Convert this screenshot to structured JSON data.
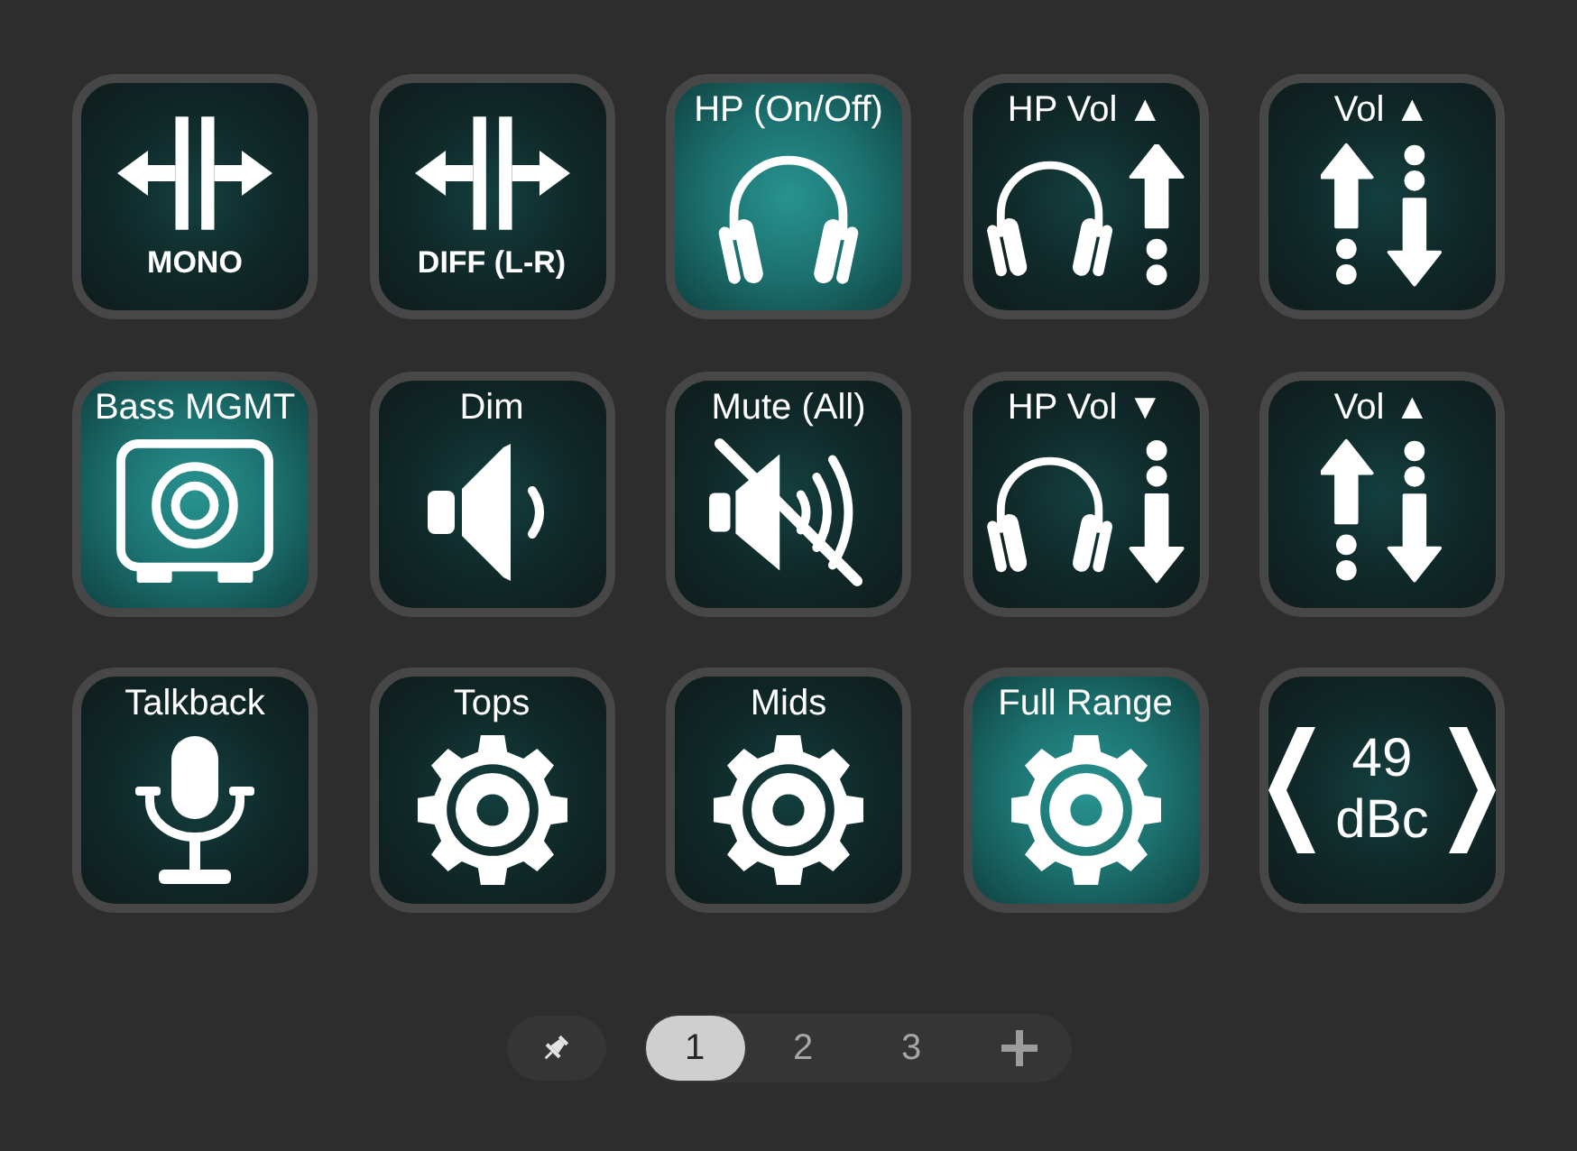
{
  "keys": [
    {
      "kind": "caption",
      "label": "MONO",
      "on": false
    },
    {
      "kind": "caption",
      "label": "DIFF (L-R)",
      "on": false
    },
    {
      "kind": "titled",
      "label": "HP (On/Off)",
      "on": true
    },
    {
      "kind": "titled",
      "label": "HP Vol ▲",
      "on": false
    },
    {
      "kind": "titled",
      "label": "Vol ▲",
      "on": false
    },
    {
      "kind": "titled",
      "label": "Bass MGMT",
      "on": true
    },
    {
      "kind": "titled",
      "label": "Dim",
      "on": false
    },
    {
      "kind": "titled",
      "label": "Mute (All)",
      "on": false
    },
    {
      "kind": "titled",
      "label": "HP Vol ▼",
      "on": false
    },
    {
      "kind": "titled",
      "label": "Vol ▲",
      "on": false
    },
    {
      "kind": "titled",
      "label": "Talkback",
      "on": false
    },
    {
      "kind": "titled",
      "label": "Tops",
      "on": false
    },
    {
      "kind": "titled",
      "label": "Mids",
      "on": false
    },
    {
      "kind": "titled",
      "label": "Full Range",
      "on": true
    },
    {
      "kind": "stepper",
      "value": "49",
      "unit": "dBc",
      "on": false
    }
  ],
  "pager": {
    "pages": [
      {
        "label": "1",
        "selected": true
      },
      {
        "label": "2",
        "selected": false
      },
      {
        "label": "3",
        "selected": false
      }
    ]
  }
}
